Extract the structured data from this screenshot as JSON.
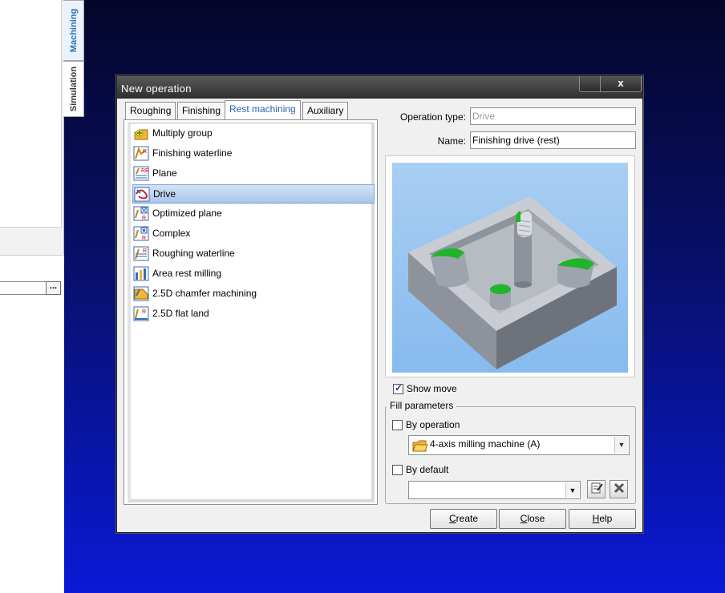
{
  "side_tabs": {
    "machining": "Machining",
    "simulation": "Simulation"
  },
  "left_panel": {
    "ellipsis_label": "..."
  },
  "dialog": {
    "title": "New operation",
    "close_label": "x",
    "tabs": [
      {
        "label": "Roughing"
      },
      {
        "label": "Finishing"
      },
      {
        "label": "Rest machining",
        "active": true
      },
      {
        "label": "Auxiliary"
      }
    ],
    "operations": [
      {
        "label": "Multiply group",
        "icon": "multiply-group-icon"
      },
      {
        "label": "Finishing waterline",
        "icon": "finishing-waterline-icon"
      },
      {
        "label": "Plane",
        "icon": "plane-icon"
      },
      {
        "label": "Drive",
        "icon": "drive-icon",
        "selected": true
      },
      {
        "label": "Optimized plane",
        "icon": "optimized-plane-icon"
      },
      {
        "label": "Complex",
        "icon": "complex-icon"
      },
      {
        "label": "Roughing waterline",
        "icon": "roughing-waterline-icon"
      },
      {
        "label": "Area rest milling",
        "icon": "area-rest-milling-icon"
      },
      {
        "label": "2.5D chamfer machining",
        "icon": "chamfer-icon"
      },
      {
        "label": "2.5D flat land",
        "icon": "flat-land-icon"
      }
    ],
    "operation_type": {
      "label": "Operation type:",
      "value": "Drive"
    },
    "name": {
      "label": "Name:",
      "value": "Finishing drive (rest)"
    },
    "show_move": {
      "label": "Show move",
      "checked": true
    },
    "fill_parameters": {
      "legend": "Fill parameters",
      "by_operation": {
        "label": "By operation",
        "checked": false,
        "value": "4-axis milling machine (A)"
      },
      "by_default": {
        "label": "By default",
        "checked": false,
        "value": ""
      }
    },
    "buttons": {
      "create": "Create",
      "close": "Close",
      "help": "Help"
    }
  },
  "colors": {
    "selection": "#a9c6ea",
    "titlebar": "#2e2e2e",
    "desktop": "#0a19d6",
    "part_green": "#1fb52a",
    "part_gray": "#9ea4ad"
  }
}
